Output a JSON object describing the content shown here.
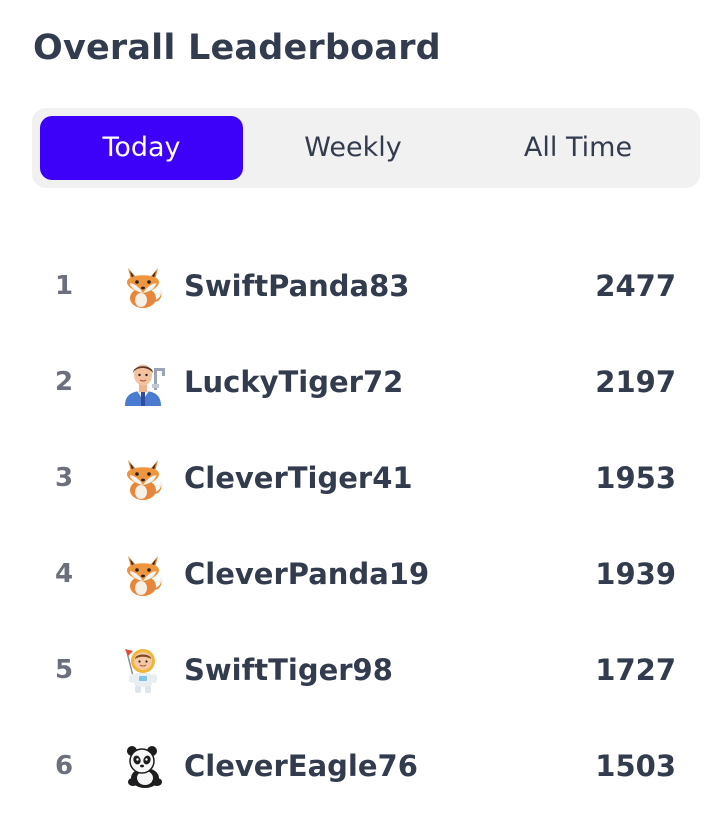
{
  "title": "Overall Leaderboard",
  "tabs": [
    {
      "label": "Today",
      "active": true
    },
    {
      "label": "Weekly",
      "active": false
    },
    {
      "label": "All Time",
      "active": false
    }
  ],
  "colors": {
    "accent": "#3d00f8",
    "text": "#333b4f",
    "rank_text": "#6c6f7c",
    "tab_bg": "#f1f1f1"
  },
  "leaderboard": [
    {
      "rank": "1",
      "name": "SwiftPanda83",
      "score": "2477",
      "avatar": "fox-icon"
    },
    {
      "rank": "2",
      "name": "LuckyTiger72",
      "score": "2197",
      "avatar": "plumber-icon"
    },
    {
      "rank": "3",
      "name": "CleverTiger41",
      "score": "1953",
      "avatar": "fox-icon"
    },
    {
      "rank": "4",
      "name": "CleverPanda19",
      "score": "1939",
      "avatar": "fox-icon"
    },
    {
      "rank": "5",
      "name": "SwiftTiger98",
      "score": "1727",
      "avatar": "astronaut-icon"
    },
    {
      "rank": "6",
      "name": "CleverEagle76",
      "score": "1503",
      "avatar": "panda-icon"
    }
  ]
}
